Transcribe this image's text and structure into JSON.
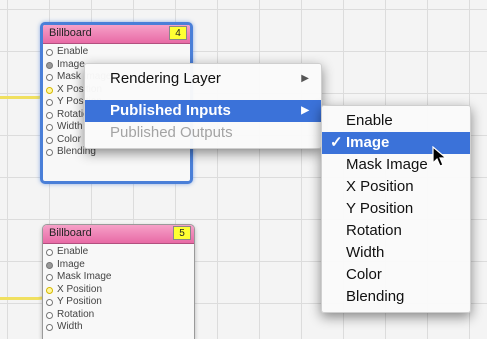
{
  "patches": [
    {
      "title": "Billboard",
      "index": "4",
      "ports": [
        {
          "label": "Enable",
          "state": "empty"
        },
        {
          "label": "Image",
          "state": "filled"
        },
        {
          "label": "Mask Image",
          "state": "empty"
        },
        {
          "label": "X Position",
          "state": "connected"
        },
        {
          "label": "Y Position",
          "state": "empty"
        },
        {
          "label": "Rotation",
          "state": "empty"
        },
        {
          "label": "Width",
          "state": "empty"
        },
        {
          "label": "Color",
          "state": "empty"
        },
        {
          "label": "Blending",
          "state": "empty"
        }
      ]
    },
    {
      "title": "Billboard",
      "index": "5",
      "ports": [
        {
          "label": "Enable",
          "state": "empty"
        },
        {
          "label": "Image",
          "state": "filled"
        },
        {
          "label": "Mask Image",
          "state": "empty"
        },
        {
          "label": "X Position",
          "state": "connected"
        },
        {
          "label": "Y Position",
          "state": "empty"
        },
        {
          "label": "Rotation",
          "state": "empty"
        },
        {
          "label": "Width",
          "state": "empty"
        }
      ]
    }
  ],
  "context_menu": {
    "items": [
      {
        "label": "Rendering Layer",
        "has_submenu": true,
        "highlighted": false,
        "disabled": false
      },
      {
        "label": "Published Inputs",
        "has_submenu": true,
        "highlighted": true,
        "disabled": false
      },
      {
        "label": "Published Outputs",
        "has_submenu": false,
        "highlighted": false,
        "disabled": true
      }
    ]
  },
  "submenu": {
    "check_mark": "✓",
    "items": [
      {
        "label": "Enable",
        "checked": false,
        "highlighted": false
      },
      {
        "label": "Image",
        "checked": true,
        "highlighted": true
      },
      {
        "label": "Mask Image",
        "checked": false,
        "highlighted": false
      },
      {
        "label": "X Position",
        "checked": false,
        "highlighted": false
      },
      {
        "label": "Y Position",
        "checked": false,
        "highlighted": false
      },
      {
        "label": "Rotation",
        "checked": false,
        "highlighted": false
      },
      {
        "label": "Width",
        "checked": false,
        "highlighted": false
      },
      {
        "label": "Color",
        "checked": false,
        "highlighted": false
      },
      {
        "label": "Blending",
        "checked": false,
        "highlighted": false
      }
    ]
  },
  "colors": {
    "highlight": "#3b72d9",
    "patch_header": "#ee7bb4",
    "index_badge": "#ffff33",
    "selection_border": "#4a7fd8",
    "cable": "#f0e060"
  }
}
